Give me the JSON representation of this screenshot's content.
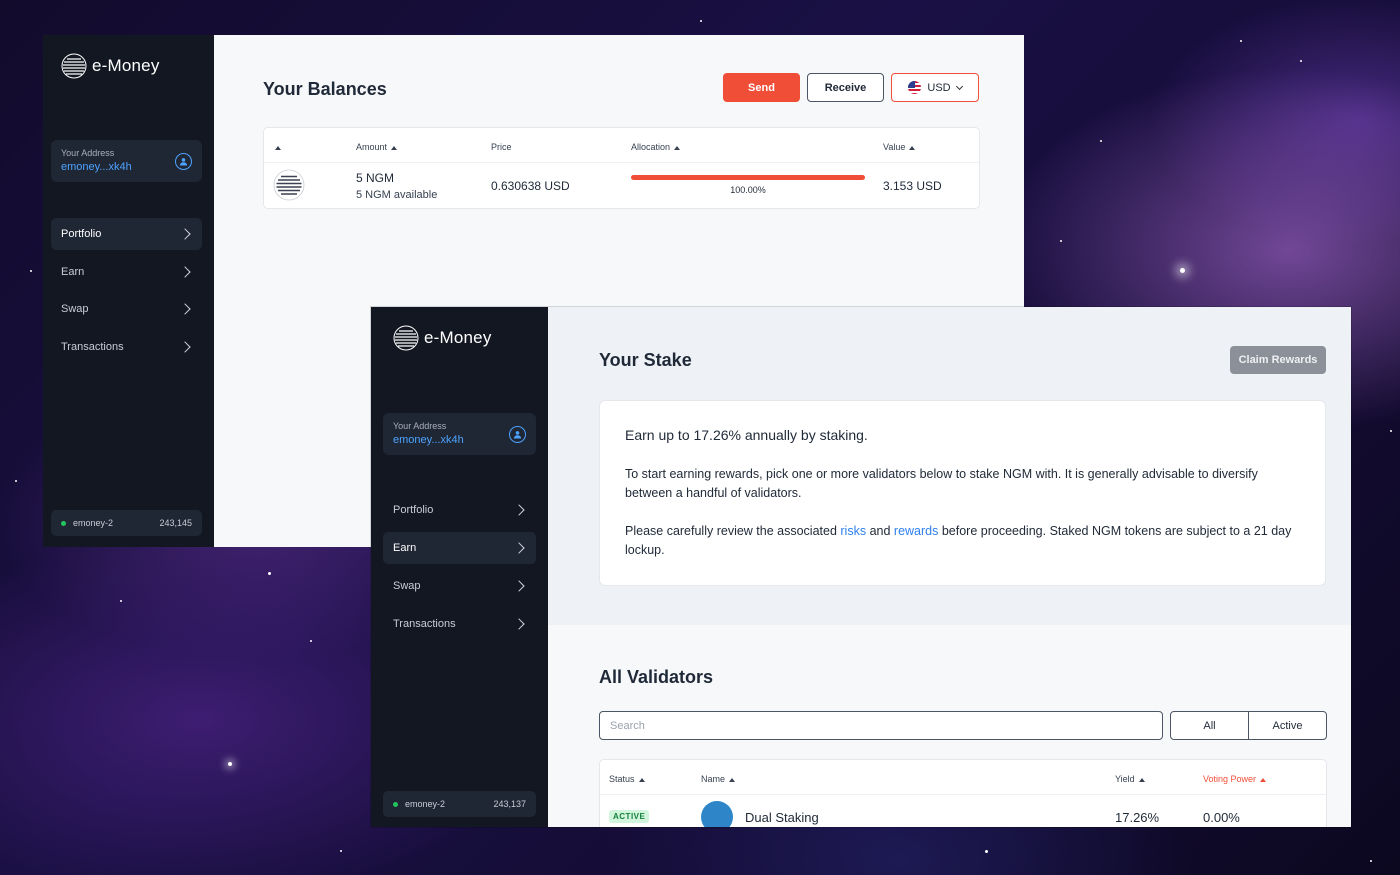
{
  "brand": {
    "name": "e-Money"
  },
  "portfolio_window": {
    "sidebar": {
      "address_label": "Your Address",
      "address_value": "emoney...xk4h",
      "nav": [
        {
          "label": "Portfolio",
          "active": true
        },
        {
          "label": "Earn",
          "active": false
        },
        {
          "label": "Swap",
          "active": false
        },
        {
          "label": "Transactions",
          "active": false
        }
      ],
      "network": {
        "name": "emoney-2",
        "height": "243,145"
      }
    },
    "main": {
      "title": "Your Balances",
      "send_label": "Send",
      "receive_label": "Receive",
      "currency": "USD",
      "table": {
        "headers": {
          "amount": "Amount",
          "price": "Price",
          "allocation": "Allocation",
          "value": "Value"
        },
        "rows": [
          {
            "amount": "5 NGM",
            "available": "5 NGM available",
            "price": "0.630638 USD",
            "allocation_pct": "100.00%",
            "allocation_fraction": 1.0,
            "value": "3.153 USD"
          }
        ]
      }
    }
  },
  "stake_window": {
    "sidebar": {
      "address_label": "Your Address",
      "address_value": "emoney...xk4h",
      "nav": [
        {
          "label": "Portfolio",
          "active": false
        },
        {
          "label": "Earn",
          "active": true
        },
        {
          "label": "Swap",
          "active": false
        },
        {
          "label": "Transactions",
          "active": false
        }
      ],
      "network": {
        "name": "emoney-2",
        "height": "243,137"
      }
    },
    "main": {
      "title": "Your Stake",
      "claim_label": "Claim Rewards",
      "info": {
        "lead": "Earn up to 17.26% annually by staking.",
        "p1": "To start earning rewards, pick one or more validators below to stake NGM with. It is generally advisable to diversify between a handful of validators.",
        "p2_before": "Please carefully review the associated ",
        "p2_link1": "risks",
        "p2_mid": " and ",
        "p2_link2": "rewards",
        "p2_after": " before proceeding. Staked NGM tokens are subject to a 21 day lockup."
      },
      "validators_title": "All Validators",
      "search_placeholder": "Search",
      "filter_all": "All",
      "filter_active": "Active",
      "table": {
        "headers": {
          "status": "Status",
          "name": "Name",
          "yield": "Yield",
          "voting_power": "Voting Power"
        },
        "rows": [
          {
            "status": "ACTIVE",
            "name": "Dual Staking",
            "yield": "17.26%",
            "voting_power": "0.00%"
          }
        ]
      }
    }
  },
  "colors": {
    "accent": "#f04e37",
    "link": "#2f80ed",
    "sidebar_bg": "#131722"
  }
}
